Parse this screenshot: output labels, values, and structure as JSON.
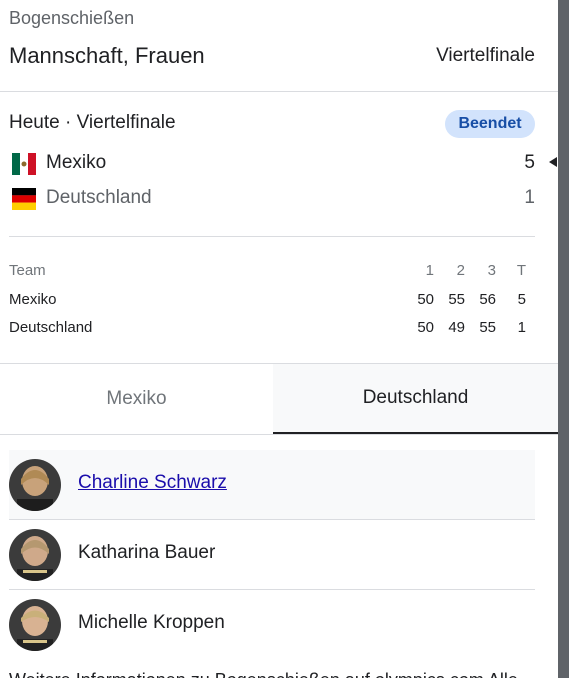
{
  "header": {
    "sport": "Bogenschießen",
    "event": "Mannschaft, Frauen",
    "stage": "Viertelfinale"
  },
  "match": {
    "when": "Heute · Viertelfinale",
    "status": "Beendet",
    "teams": [
      {
        "name": "Mexiko",
        "score": "5",
        "flag_icon": "mexico-flag-icon",
        "winner": true
      },
      {
        "name": "Deutschland",
        "score": "1",
        "flag_icon": "germany-flag-icon",
        "winner": false
      }
    ]
  },
  "score_table": {
    "headers": [
      "Team",
      "1",
      "2",
      "3",
      "T"
    ],
    "rows": [
      {
        "team": "Mexiko",
        "s1": "50",
        "s2": "55",
        "s3": "56",
        "t": "5"
      },
      {
        "team": "Deutschland",
        "s1": "50",
        "s2": "49",
        "s3": "55",
        "t": "1"
      }
    ]
  },
  "tabs": {
    "items": [
      {
        "label": "Mexiko",
        "selected": false
      },
      {
        "label": "Deutschland",
        "selected": true
      }
    ]
  },
  "players": [
    {
      "name": "Charline Schwarz"
    },
    {
      "name": "Katharina Bauer"
    },
    {
      "name": "Michelle Kroppen"
    }
  ],
  "footer": {
    "text": "Weitere Informationen zu Bogenschießen auf olympics.com Alle"
  },
  "colors": {
    "badge_bg": "#d2e3fc",
    "badge_text": "#174ea6",
    "divider": "#dadce0",
    "scrollbar": "#5f6368"
  }
}
